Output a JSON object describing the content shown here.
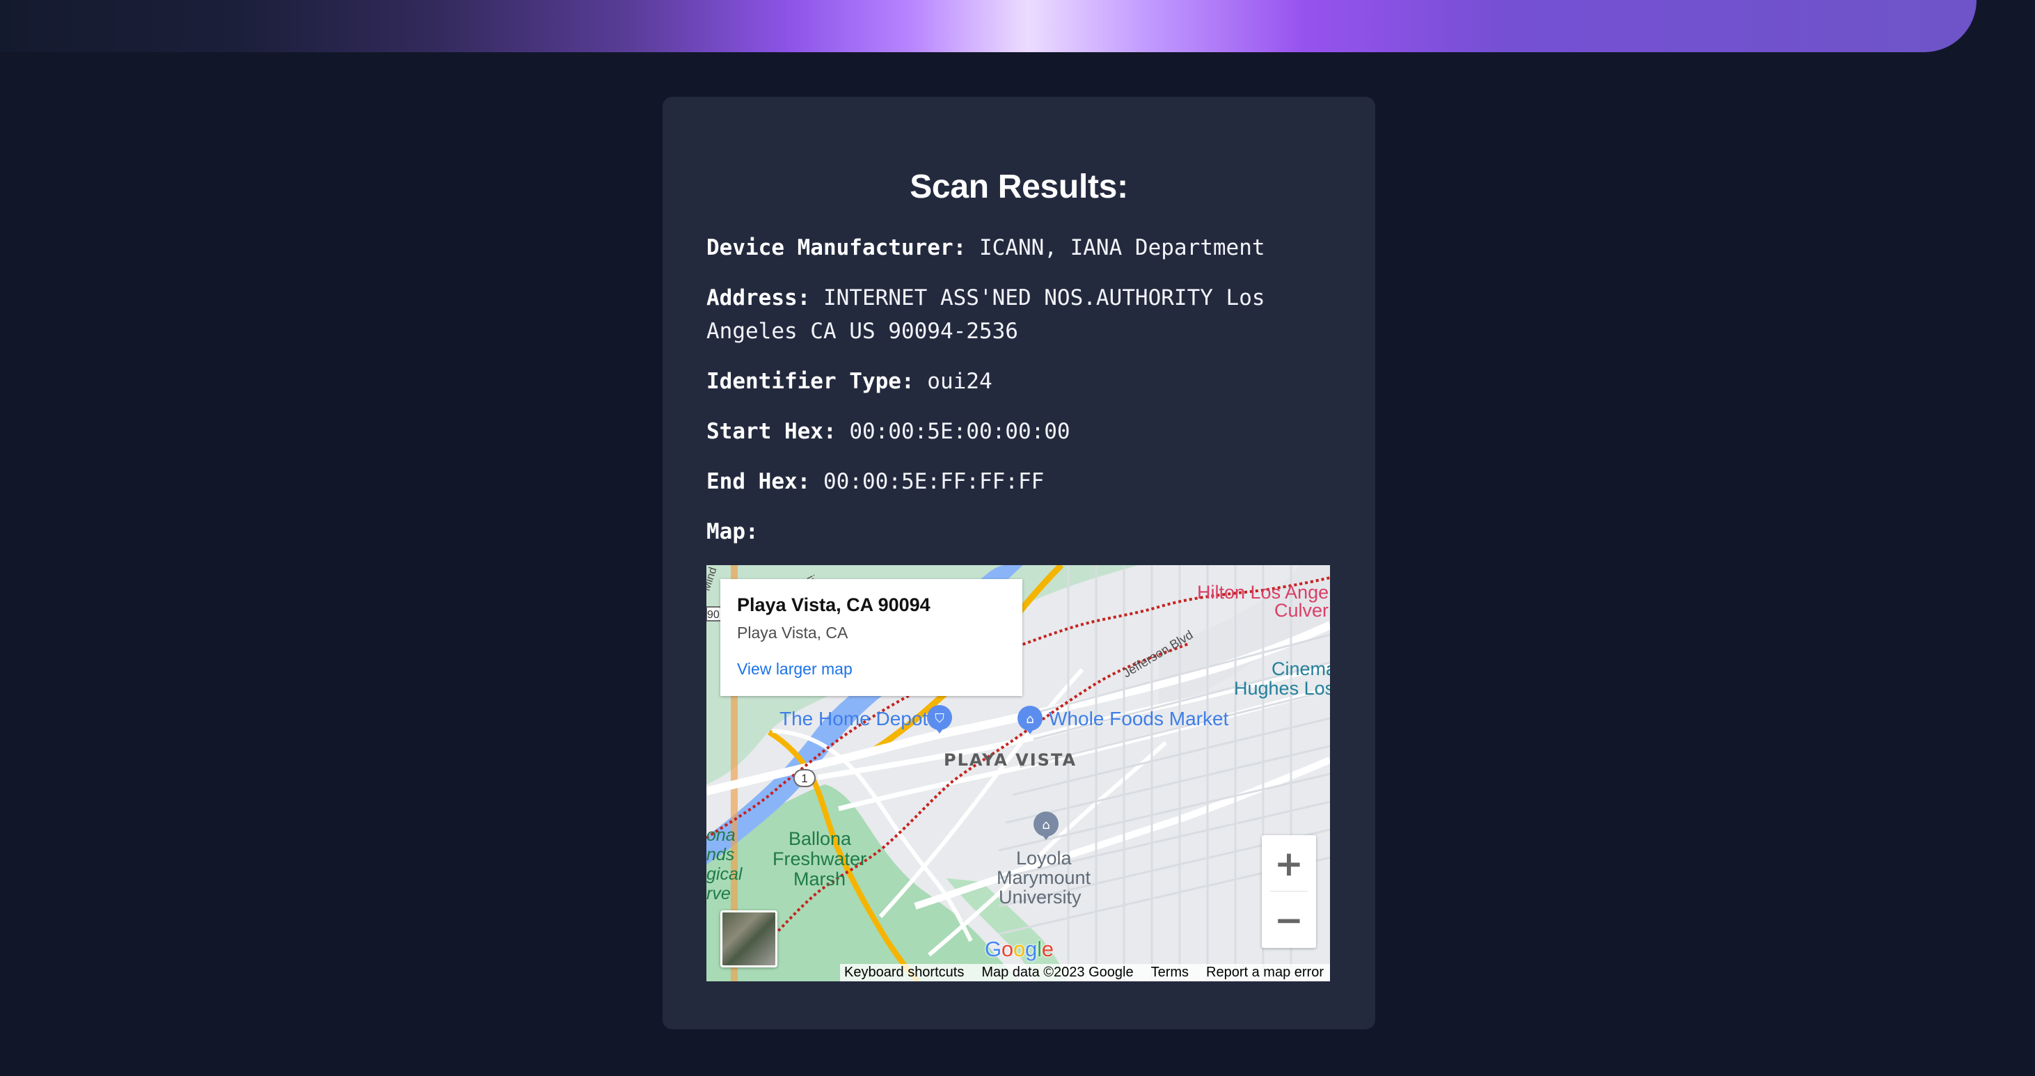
{
  "page": {
    "accent": "#8d54e8"
  },
  "scan": {
    "title": "Scan Results:",
    "fields": [
      {
        "label": "Device Manufacturer:",
        "value": "ICANN, IANA Department"
      },
      {
        "label": "Address:",
        "value": "INTERNET ASS'NED NOS.AUTHORITY Los Angeles CA US 90094-2536"
      },
      {
        "label": "Identifier Type:",
        "value": "oui24"
      },
      {
        "label": "Start Hex:",
        "value": "00:00:5E:00:00:00"
      },
      {
        "label": "End Hex:",
        "value": "00:00:5E:FF:FF:FF"
      }
    ],
    "map_label": "Map:"
  },
  "map": {
    "place_title": "Playa Vista, CA 90094",
    "place_subtitle": "Playa Vista, CA",
    "larger_map_link": "View larger map",
    "zoom_in": "+",
    "zoom_out": "−",
    "footer": {
      "keyboard": "Keyboard shortcuts",
      "data": "Map data ©2023 Google",
      "terms": "Terms",
      "report": "Report a map error"
    },
    "google_logo": [
      "G",
      "o",
      "o",
      "g",
      "l",
      "e"
    ],
    "labels": {
      "home_depot": "The Home Depot",
      "whole_foods": "Whole Foods Market",
      "playa_vista": "PLAYA VISTA",
      "jefferson": "Jefferson Blvd",
      "hilton_1": "Hilton Los Ange",
      "hilton_2": "Culver",
      "cinema_1": "Cinema",
      "cinema_2": "Hughes Los",
      "ballona_1": "Ballona",
      "ballona_2": "Freshwater",
      "ballona_3": "Marsh",
      "lmu_1": "Loyola",
      "lmu_2": "Marymount",
      "lmu_3": "University",
      "route_1": "1",
      "route_90": "90",
      "edge_1": "ona",
      "edge_2": "nds",
      "edge_3": "gical",
      "edge_4": "rve",
      "edge_5": "Mind",
      "edge_6": "ia"
    },
    "icons": {
      "home_depot": "shopping-bag-icon",
      "whole_foods": "shopping-cart-icon",
      "lmu": "graduation-cap-icon"
    }
  }
}
